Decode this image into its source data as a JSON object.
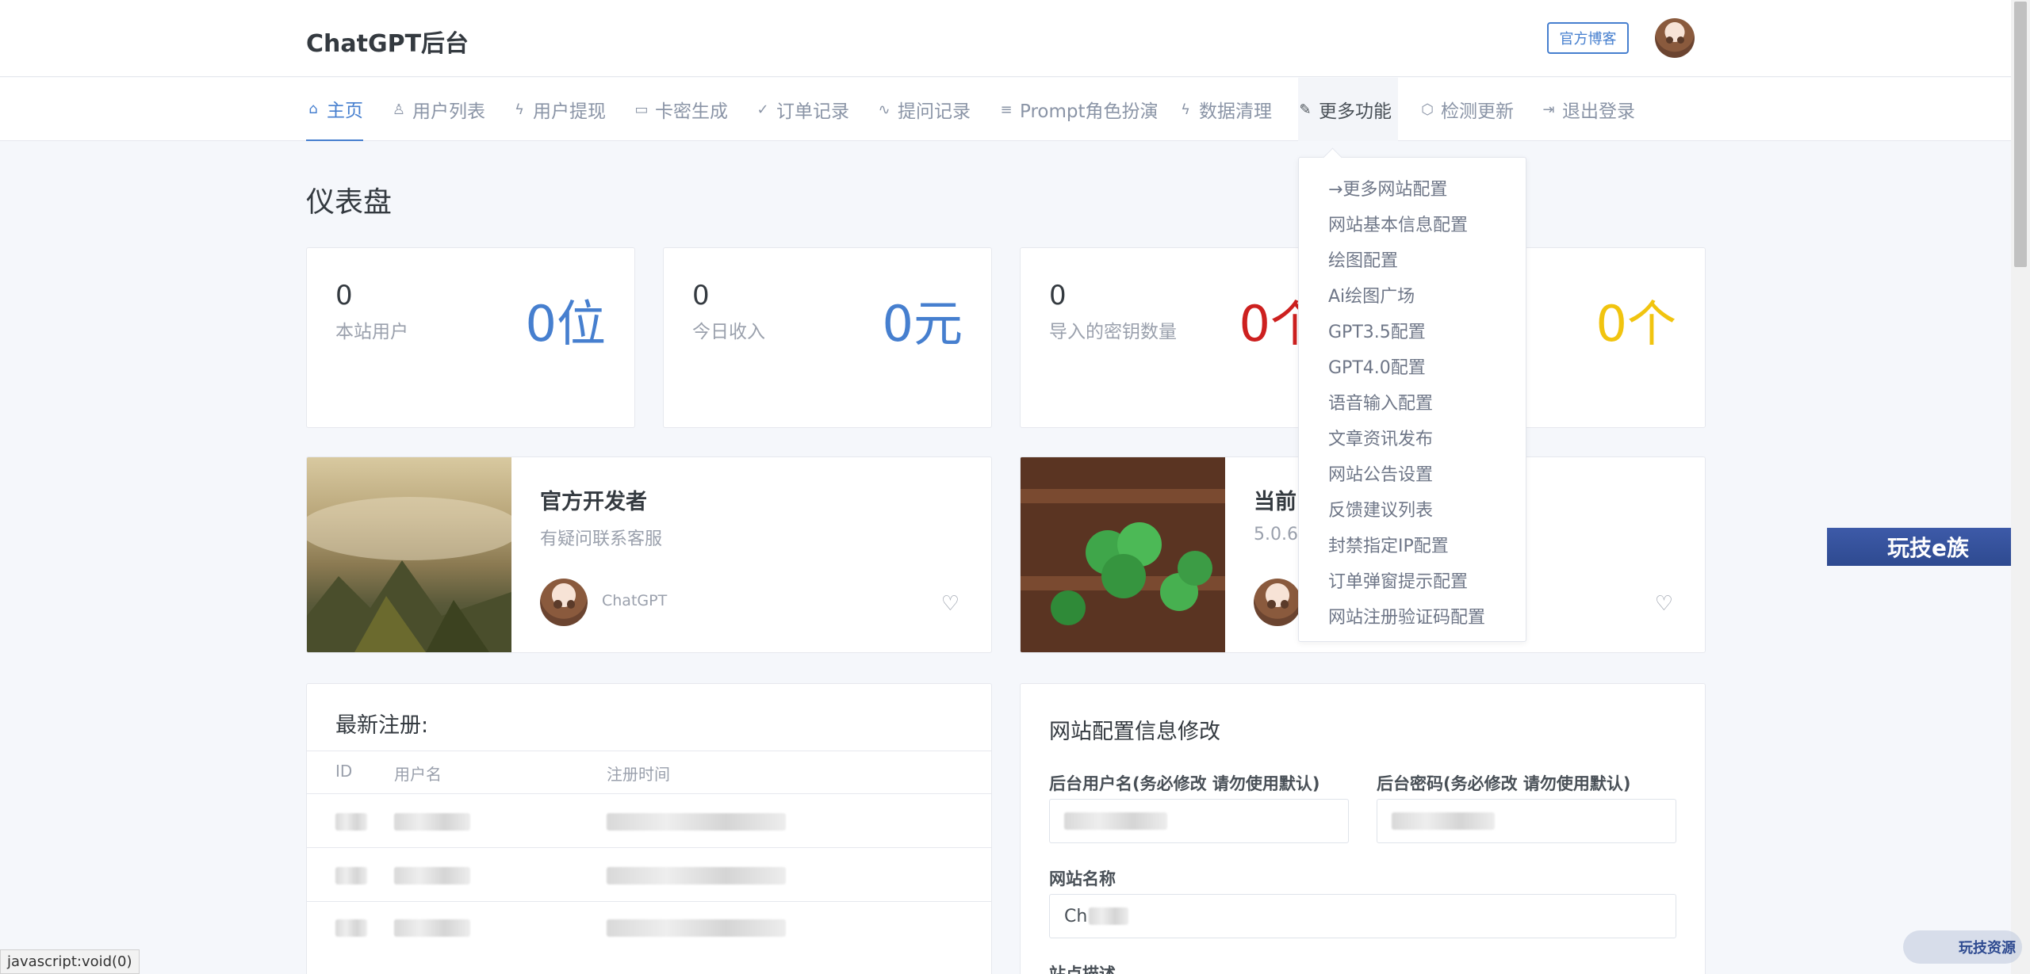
{
  "header": {
    "brand": "ChatGPT后台",
    "blog_button": "官方博客"
  },
  "nav": {
    "items": [
      {
        "label": "主页",
        "icon": "home-icon"
      },
      {
        "label": "用户列表",
        "icon": "user-icon"
      },
      {
        "label": "用户提现",
        "icon": "bolt-icon"
      },
      {
        "label": "卡密生成",
        "icon": "calendar-icon"
      },
      {
        "label": "订单记录",
        "icon": "check-circle-icon"
      },
      {
        "label": "提问记录",
        "icon": "activity-icon"
      },
      {
        "label": "Prompt角色扮演",
        "icon": "database-icon"
      },
      {
        "label": "数据清理",
        "icon": "bolt-icon"
      },
      {
        "label": "更多功能",
        "icon": "pen-icon"
      },
      {
        "label": "检测更新",
        "icon": "box-icon"
      },
      {
        "label": "退出登录",
        "icon": "logout-icon"
      }
    ],
    "active_index": 0,
    "open_index": 8
  },
  "page_title": "仪表盘",
  "stats": [
    {
      "value": "0",
      "label": "本站用户",
      "big": "0位",
      "color": "#467fcf"
    },
    {
      "value": "0",
      "label": "今日收入",
      "big": "0元",
      "color": "#467fcf"
    },
    {
      "value": "0",
      "label": "导入的密钥数量",
      "big": "0个",
      "color": "#cd201f"
    },
    {
      "big": "0个",
      "color": "#f1c40f"
    }
  ],
  "developer_card": {
    "title": "官方开发者",
    "subtitle": "有疑问联系客服",
    "author": "ChatGPT"
  },
  "version_card": {
    "title": "当前",
    "version": "5.0.6"
  },
  "latest_users": {
    "title": "最新注册:",
    "columns": [
      "ID",
      "用户名",
      "注册时间"
    ]
  },
  "config_form": {
    "title": "网站配置信息修改",
    "admin_user_label": "后台用户名(务必修改 请勿使用默认)",
    "admin_pass_label": "后台密码(务必修改 请勿使用默认)",
    "site_name_label": "网站名称",
    "site_name_value": "Ch",
    "site_desc_label": "站点描述"
  },
  "dropdown": {
    "items": [
      "→更多网站配置",
      "网站基本信息配置",
      "绘图配置",
      "Ai绘图广场",
      "GPT3.5配置",
      "GPT4.0配置",
      "语音输入配置",
      "文章资讯发布",
      "网站公告设置",
      "反馈建议列表",
      "封禁指定IP配置",
      "订单弹窗提示配置",
      "网站注册验证码配置"
    ]
  },
  "side_badge": "玩技e族",
  "status_bar": "javascript:void(0)",
  "watermark": "玩技资源"
}
